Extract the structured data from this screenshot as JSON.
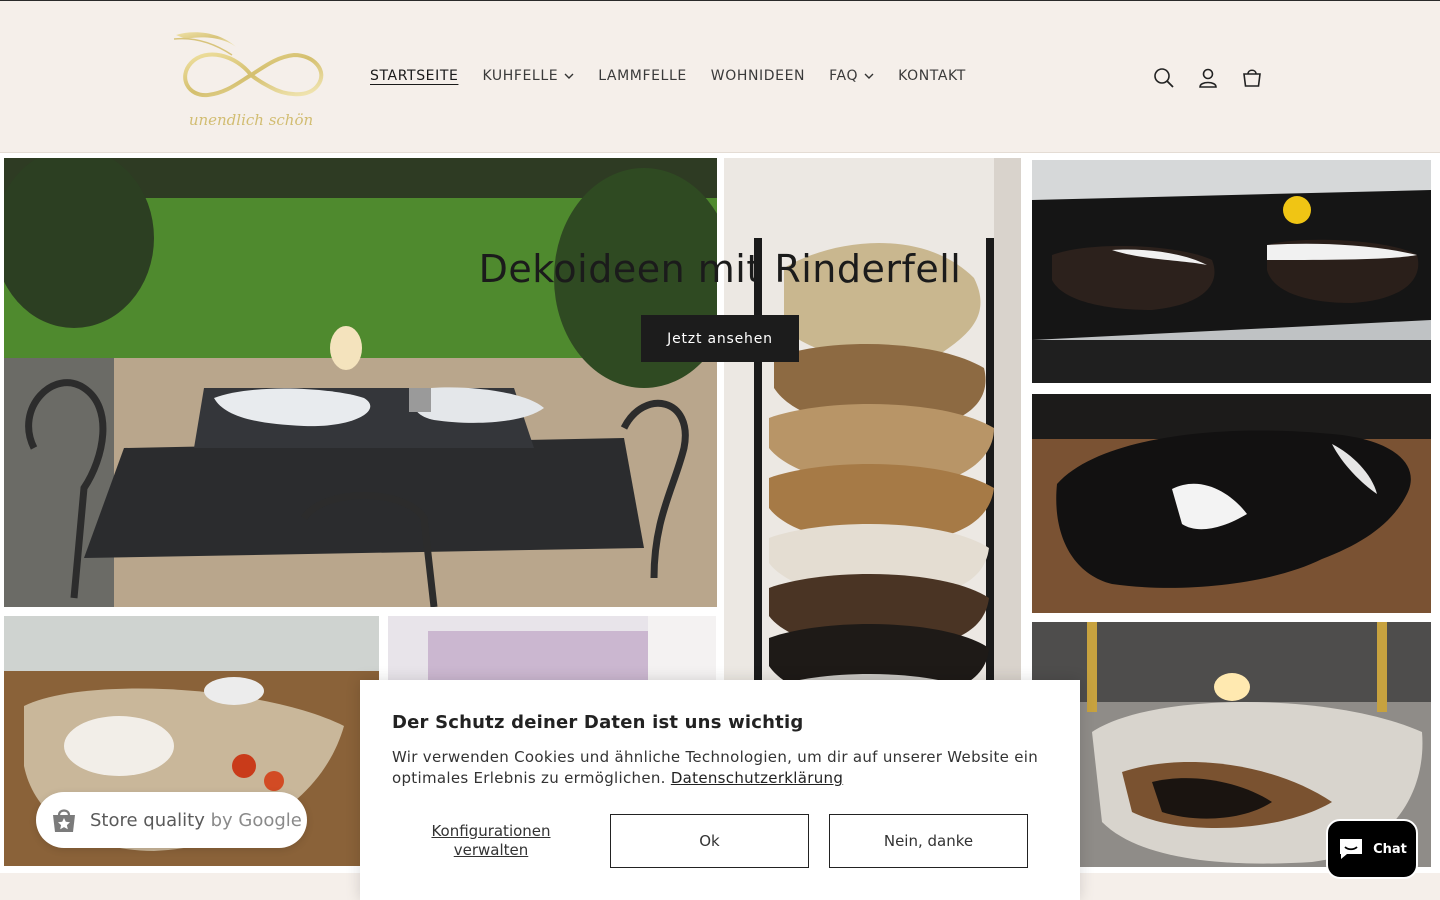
{
  "logo": {
    "script_text": "unendlich schön"
  },
  "nav": {
    "items": [
      {
        "label": "STARTSEITE",
        "active": true,
        "has_dropdown": false
      },
      {
        "label": "KUHFELLE",
        "active": false,
        "has_dropdown": true
      },
      {
        "label": "LAMMFELLE",
        "active": false,
        "has_dropdown": false
      },
      {
        "label": "WOHNIDEEN",
        "active": false,
        "has_dropdown": false
      },
      {
        "label": "FAQ",
        "active": false,
        "has_dropdown": true
      },
      {
        "label": "KONTAKT",
        "active": false,
        "has_dropdown": false
      }
    ]
  },
  "header_icons": [
    "search-icon",
    "account-icon",
    "cart-icon"
  ],
  "hero": {
    "heading": "Dekoideen mit Rinderfell",
    "button_label": "Jetzt ansehen"
  },
  "cookie_banner": {
    "title": "Der Schutz deiner Daten ist uns wichtig",
    "text": "Wir verwenden Cookies und ähnliche Technologien, um dir auf unserer Website ein optimales Erlebnis zu ermöglichen.",
    "privacy_link": "Datenschutzerklärung",
    "configure_label": "Konfigurationen verwalten",
    "ok_label": "Ok",
    "decline_label": "Nein, danke"
  },
  "google_badge": {
    "text_main": "Store quality",
    "text_brand": "by Google"
  },
  "chat": {
    "label": "Chat"
  },
  "colors": {
    "background": "#f5efea",
    "button_dark": "#1c1c1c",
    "logo_gold": "#d6c37a"
  }
}
